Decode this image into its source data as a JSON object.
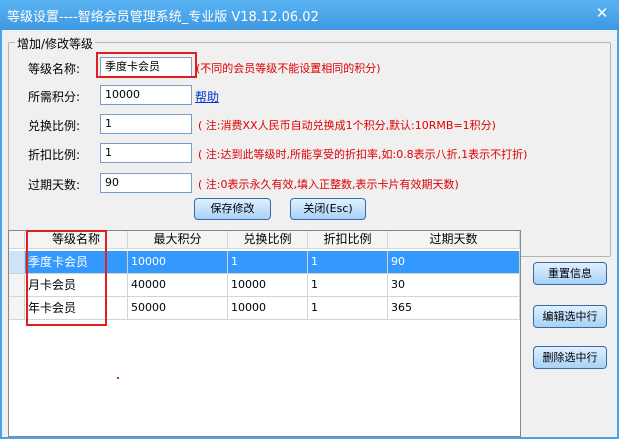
{
  "window": {
    "title": "等级设置----智络会员管理系统_专业版 V18.12.06.02",
    "close_glyph": "✕"
  },
  "form": {
    "group_title": "增加/修改等级",
    "fields": [
      {
        "label": "等级名称:",
        "value": "季度卡会员",
        "hint": "(不同的会员等级不能设置相同的积分)"
      },
      {
        "label": "所需积分:",
        "value": "10000",
        "link": "帮助"
      },
      {
        "label": "兑换比例:",
        "value": "1",
        "hint": "( 注:消费XX人民币自动兑换成1个积分,默认:10RMB=1积分)"
      },
      {
        "label": "折扣比例:",
        "value": "1",
        "hint": "( 注:达到此等级时,所能享受的折扣率,如:0.8表示八折,1表示不打折)"
      },
      {
        "label": "过期天数:",
        "value": "90",
        "hint": "( 注:0表示永久有效,填入正整数,表示卡片有效期天数)"
      }
    ],
    "save_label": "保存修改",
    "close_label": "关闭(Esc)"
  },
  "table": {
    "columns": [
      "等级名称",
      "最大积分",
      "兑换比例",
      "折扣比例",
      "过期天数"
    ],
    "rows": [
      [
        "季度卡会员",
        "10000",
        "1",
        "1",
        "90"
      ],
      [
        "月卡会员",
        "40000",
        "10000",
        "1",
        "30"
      ],
      [
        "年卡会员",
        "50000",
        "10000",
        "1",
        "365"
      ]
    ],
    "selected_row": 0
  },
  "side_buttons": {
    "reset_label": "重置信息",
    "edit_label": "编辑选中行",
    "delete_label": "删除选中行"
  },
  "colors": {
    "title_bar": "#3d98e2",
    "selection": "#3399ff",
    "hint_text": "#e00000",
    "annotation_box": "#e02020"
  }
}
